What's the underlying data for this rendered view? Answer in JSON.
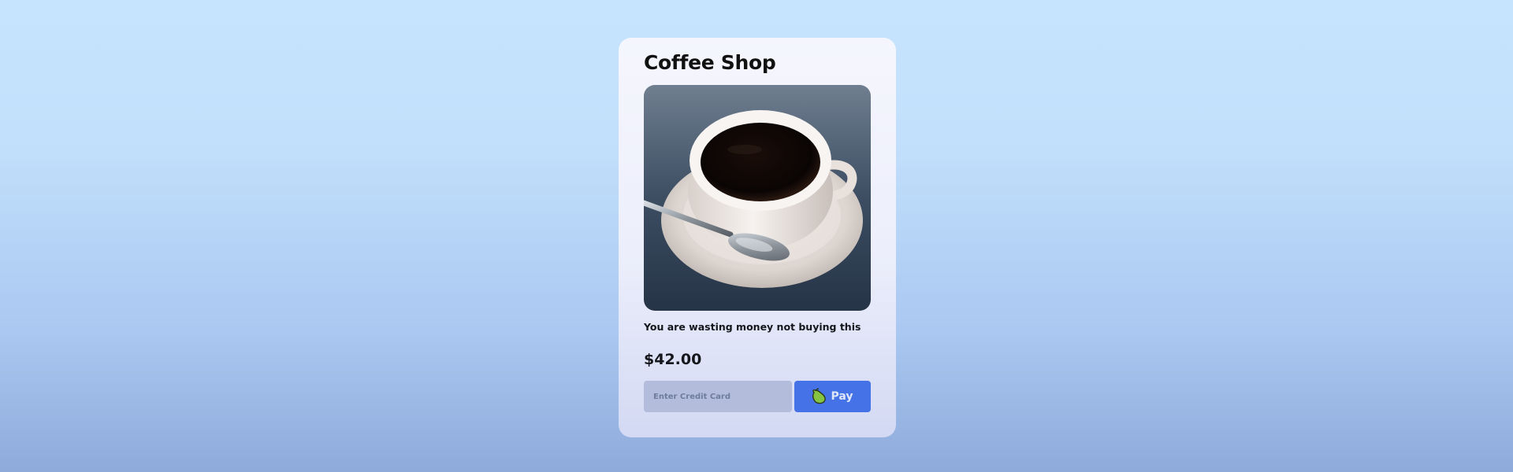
{
  "shop": {
    "title": "Coffee Shop"
  },
  "product": {
    "image_alt": "Cup of black coffee on a saucer with a spoon",
    "description": "You are wasting money not buying this",
    "price": "$42.00"
  },
  "payment": {
    "card_placeholder": "Enter Credit Card",
    "card_value": "",
    "pay_label": "Pay",
    "pay_icon": "pear-icon"
  },
  "colors": {
    "accent": "#4572e6",
    "input_bg": "#b3bddb"
  }
}
